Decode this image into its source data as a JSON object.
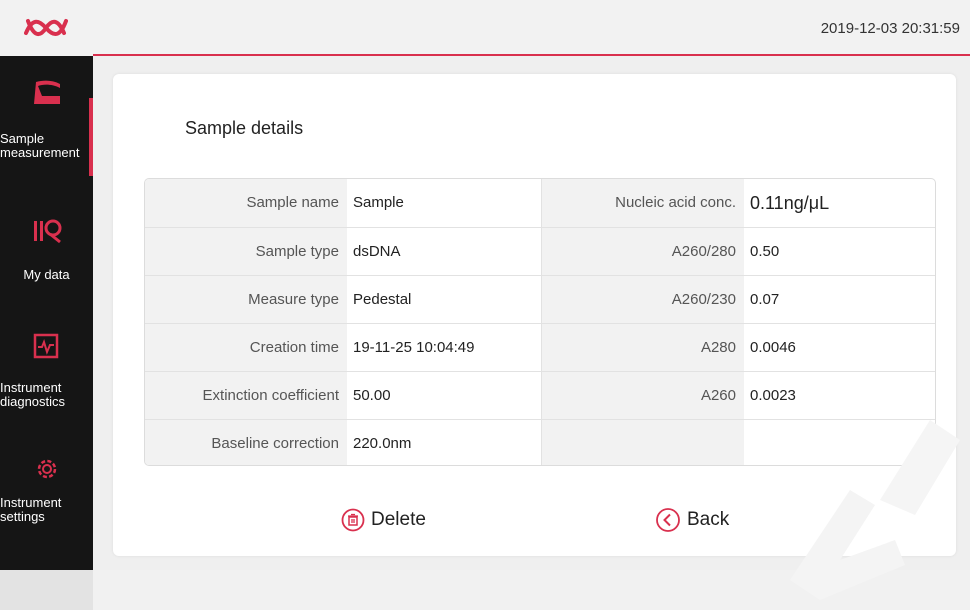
{
  "header": {
    "datetime": "2019-12-03 20:31:59"
  },
  "colors": {
    "accent": "#d9304e",
    "sidebar_bg": "#151515"
  },
  "sidebar": {
    "items": [
      {
        "label": "Sample measurement",
        "icon": "sample-measurement-icon",
        "active": true
      },
      {
        "label": "My data",
        "icon": "my-data-icon",
        "active": false
      },
      {
        "label": "Instrument diagnostics",
        "icon": "diagnostics-icon",
        "active": false
      },
      {
        "label": "Instrument settings",
        "icon": "gear-icon",
        "active": false
      }
    ]
  },
  "main": {
    "title": "Sample details",
    "left_rows": [
      {
        "label": "Sample name",
        "value": "Sample"
      },
      {
        "label": "Sample type",
        "value": "dsDNA"
      },
      {
        "label": "Measure type",
        "value": "Pedestal"
      },
      {
        "label": "Creation time",
        "value": "19-11-25 10:04:49"
      },
      {
        "label": "Extinction coefficient",
        "value": "50.00"
      },
      {
        "label": "Baseline correction",
        "value": "220.0nm"
      }
    ],
    "right_rows": [
      {
        "label": "Nucleic acid conc.",
        "value": "0.11ng/μL"
      },
      {
        "label": "A260/280",
        "value": "0.50"
      },
      {
        "label": "A260/230",
        "value": "0.07"
      },
      {
        "label": "A280",
        "value": "0.0046"
      },
      {
        "label": "A260",
        "value": "0.0023"
      },
      {
        "label": "",
        "value": ""
      }
    ],
    "buttons": {
      "delete": "Delete",
      "back": "Back"
    }
  }
}
